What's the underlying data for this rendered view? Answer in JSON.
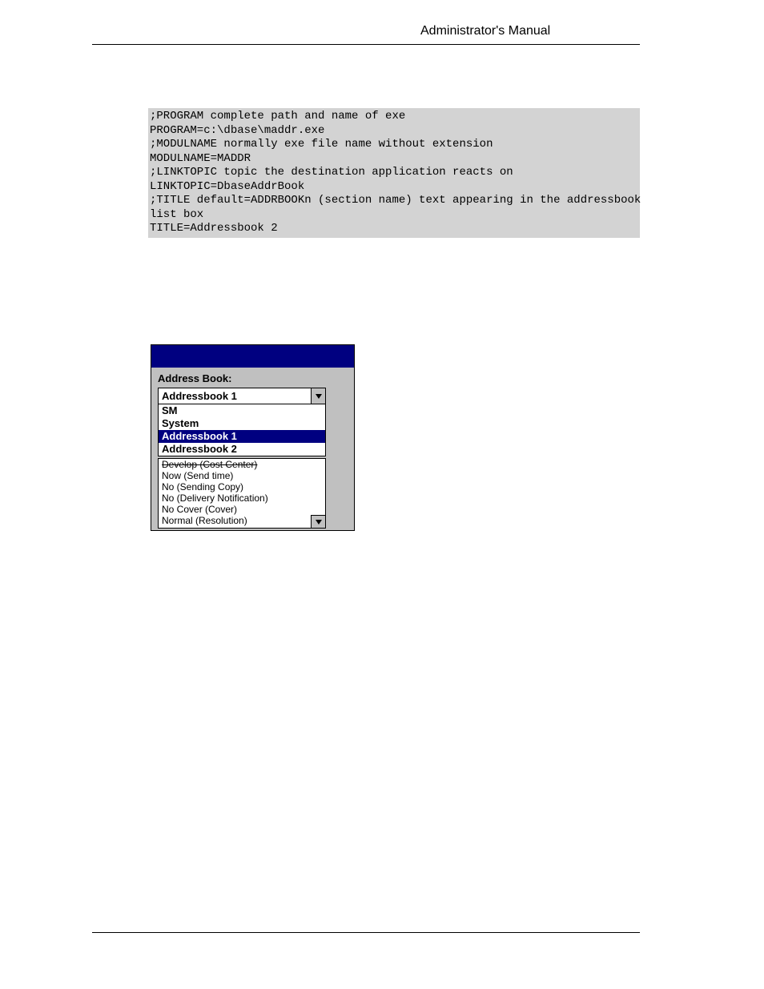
{
  "header": {
    "title": "Administrator's Manual"
  },
  "code": {
    "lines": ";PROGRAM complete path and name of exe\nPROGRAM=c:\\dbase\\maddr.exe\n;MODULNAME normally exe file name without extension\nMODULNAME=MADDR\n;LINKTOPIC topic the destination application reacts on\nLINKTOPIC=DbaseAddrBook\n;TITLE default=ADDRBOOKn (section name) text appearing in the addressbook\nlist box\nTITLE=Addressbook 2"
  },
  "dialog": {
    "label": "Address Book:",
    "combo_value": "Addressbook 1",
    "dropdown": {
      "opt0": "SM",
      "opt1": "System",
      "opt2": "Addressbook 1",
      "opt3": "Addressbook 2"
    },
    "options": {
      "r0": "Develop   (Cost Center)",
      "r1": "Now   (Send time)",
      "r2": "No   (Sending Copy)",
      "r3": "No   (Delivery Notification)",
      "r4": "No Cover   (Cover)",
      "r5": "Normal   (Resolution)"
    }
  }
}
